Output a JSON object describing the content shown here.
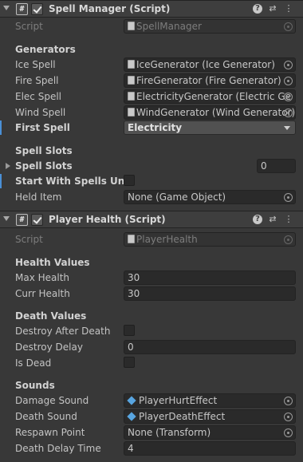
{
  "spell_manager": {
    "title": "Spell Manager (Script)",
    "script_label": "Script",
    "script_value": "SpellManager",
    "generators_header": "Generators",
    "generators": [
      {
        "label": "Ice Spell",
        "value": "IceGenerator (Ice Generator)"
      },
      {
        "label": "Fire Spell",
        "value": "FireGenerator (Fire Generator)"
      },
      {
        "label": "Elec Spell",
        "value": "ElectricityGenerator (Electric Ge"
      },
      {
        "label": "Wind Spell",
        "value": "WindGenerator (Wind Generator)"
      }
    ],
    "first_spell_label": "First Spell",
    "first_spell_value": "Electricity",
    "spell_slots_header": "Spell Slots",
    "spell_slots_label": "Spell Slots",
    "spell_slots_count": "0",
    "start_with_spells_label": "Start With Spells Unloc",
    "held_item_label": "Held Item",
    "held_item_value": "None (Game Object)"
  },
  "player_health": {
    "title": "Player Health (Script)",
    "script_label": "Script",
    "script_value": "PlayerHealth",
    "health_header": "Health Values",
    "max_health_label": "Max Health",
    "max_health_value": "30",
    "curr_health_label": "Curr Health",
    "curr_health_value": "30",
    "death_header": "Death Values",
    "destroy_after_death_label": "Destroy After Death",
    "destroy_delay_label": "Destroy Delay",
    "destroy_delay_value": "0",
    "is_dead_label": "Is Dead",
    "sounds_header": "Sounds",
    "damage_sound_label": "Damage Sound",
    "damage_sound_value": "PlayerHurtEffect",
    "death_sound_label": "Death Sound",
    "death_sound_value": "PlayerDeathEffect",
    "respawn_point_label": "Respawn Point",
    "respawn_point_value": "None (Transform)",
    "death_delay_label": "Death Delay Time",
    "death_delay_value": "4"
  },
  "header_icons": {
    "help": "?",
    "presets": "⇄",
    "menu": "⋮"
  },
  "colors": {
    "background": "#383838",
    "header": "#3e3e3e",
    "field": "#2a2a2a",
    "accent": "#4a8fd6"
  }
}
